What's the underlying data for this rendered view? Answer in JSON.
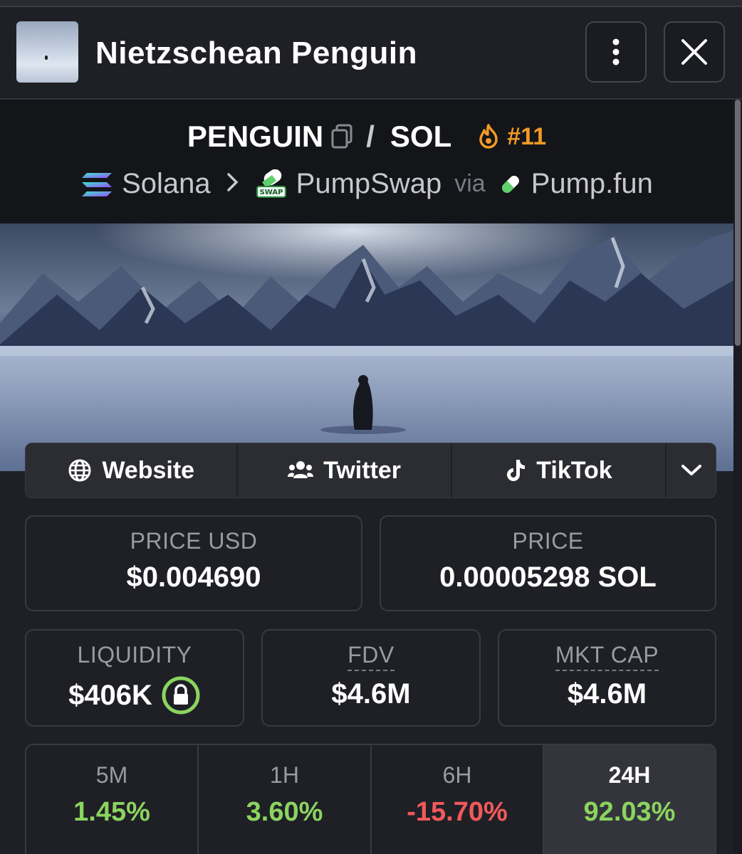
{
  "header": {
    "token_name": "Nietzschean Penguin",
    "more_icon": "vertical-dots-icon",
    "close_icon": "close-icon"
  },
  "pair": {
    "base": "PENGUIN",
    "separator": "/",
    "quote": "SOL",
    "rank": "#11",
    "rank_color": "#f29a25"
  },
  "route": {
    "chain": "Solana",
    "dex": "PumpSwap",
    "via_label": "via",
    "launchpad": "Pump.fun"
  },
  "socials": [
    {
      "label": "Website",
      "icon": "globe-icon"
    },
    {
      "label": "Twitter",
      "icon": "users-icon"
    },
    {
      "label": "TikTok",
      "icon": "tiktok-icon"
    }
  ],
  "price": {
    "usd_label": "PRICE USD",
    "usd_value": "$0.004690",
    "native_label": "PRICE",
    "native_value": "0.00005298 SOL"
  },
  "stats": {
    "liquidity_label": "LIQUIDITY",
    "liquidity_value": "$406K",
    "fdv_label": "FDV",
    "fdv_value": "$4.6M",
    "mcap_label": "MKT CAP",
    "mcap_value": "$4.6M"
  },
  "changes": [
    {
      "label": "5M",
      "value": "1.45%"
    },
    {
      "label": "1H",
      "value": "3.60%"
    },
    {
      "label": "6H",
      "value": "-15.70%"
    },
    {
      "label": "24H",
      "value": "92.03%"
    }
  ],
  "colors": {
    "positive": "#8bd45f",
    "negative": "#f15a5a",
    "lock": "#8bd45f"
  }
}
